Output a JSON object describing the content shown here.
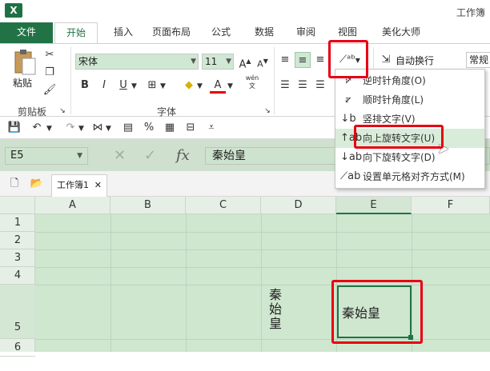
{
  "window": {
    "title": "工作簿"
  },
  "tabs": [
    "文件",
    "开始",
    "插入",
    "页面布局",
    "公式",
    "数据",
    "审阅",
    "视图",
    "美化大师"
  ],
  "ribbon": {
    "paste_label": "粘贴",
    "clipboard_group": "剪贴板",
    "font_group": "字体",
    "font_name": "宋体",
    "font_size": "11",
    "wrap_text": "自动换行",
    "number_format": "常规",
    "bold": "B",
    "italic": "I",
    "underline": "U",
    "phonetic": "wén",
    "font_color_glyph": "A"
  },
  "orientation_menu": {
    "items": [
      {
        "label": "逆时针角度(O)",
        "icon": "ccw-angle-icon"
      },
      {
        "label": "顺时针角度(L)",
        "icon": "cw-angle-icon"
      },
      {
        "label": "竖排文字(V)",
        "icon": "vertical-text-icon"
      },
      {
        "label": "向上旋转文字(U)",
        "icon": "rotate-up-icon"
      },
      {
        "label": "向下旋转文字(D)",
        "icon": "rotate-down-icon"
      },
      {
        "label": "设置单元格对齐方式(M)",
        "icon": "format-alignment-icon"
      }
    ],
    "highlighted_index": 3
  },
  "formula_bar": {
    "name_box": "E5",
    "fx": "fx",
    "value": "秦始皇"
  },
  "sheet_tabs": [
    {
      "label": "工作簿1"
    }
  ],
  "grid": {
    "columns": [
      "A",
      "B",
      "C",
      "D",
      "E",
      "F"
    ],
    "rows": [
      "1",
      "2",
      "3",
      "4",
      "5",
      "6"
    ],
    "cells": {
      "D5": "秦始皇",
      "E5": "秦始皇"
    },
    "active_cell": "E5"
  },
  "colors": {
    "accent": "#217346",
    "annotation": "#e60012",
    "sheet_bg": "#cfe6cf"
  }
}
